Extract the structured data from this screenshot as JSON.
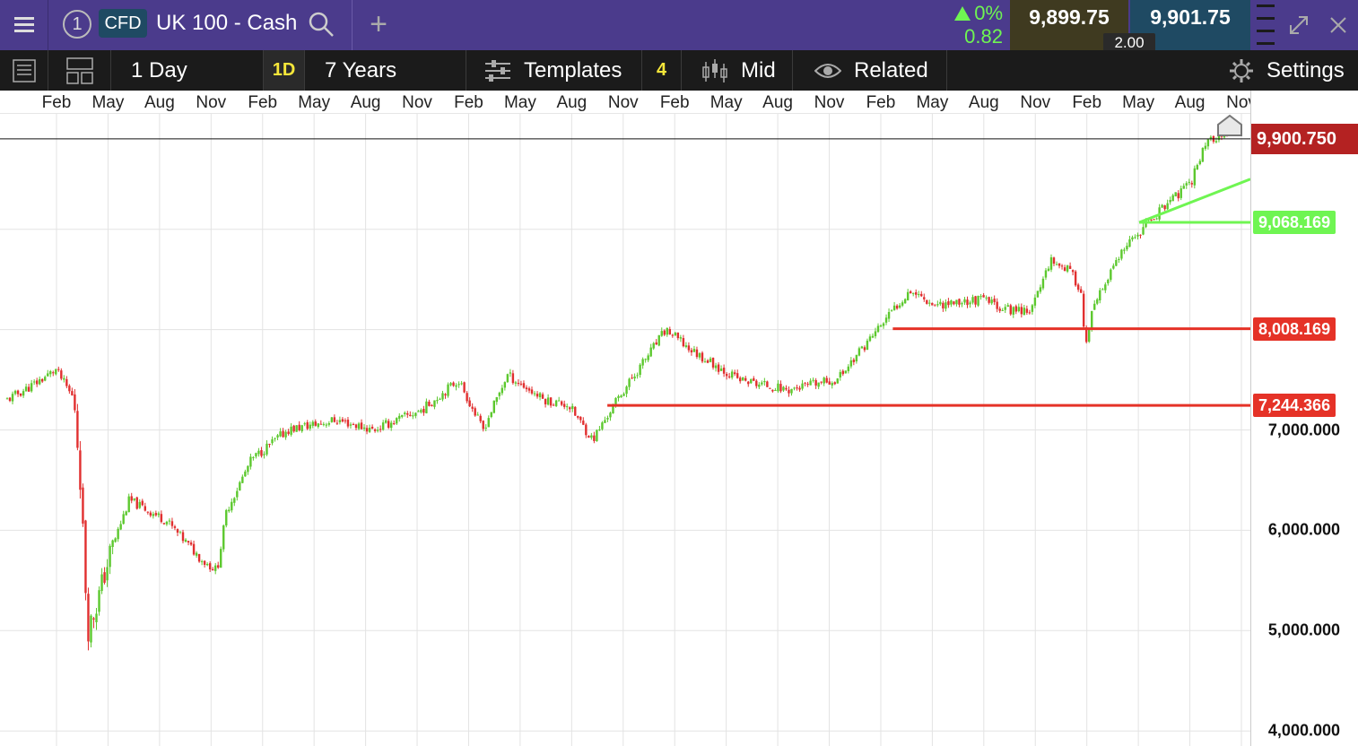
{
  "header": {
    "instrument_type": "CFD",
    "instrument_name": "UK 100 - Cash",
    "badge_number": "1",
    "add_symbol": "+",
    "change_percent": "0%",
    "change_value": "0.82",
    "sell_price": "9,899.75",
    "buy_price": "9,901.75",
    "spread": "2.00"
  },
  "toolbar": {
    "interval": "1 Day",
    "interval_code": "1D",
    "range": "7 Years",
    "templates_label": "Templates",
    "templates_count": "4",
    "price_mode": "Mid",
    "related_label": "Related",
    "settings_label": "Settings"
  },
  "colors": {
    "header_bg": "#4b3b8c",
    "toolbar_bg": "#1b1b1b",
    "up": "#5cc82e",
    "down": "#e12f2f",
    "current_price_bg": "#b42222",
    "support_line": "#e53227",
    "trend_line": "#6ff552",
    "interval_badge": "#f5e63a"
  },
  "chart_data": {
    "type": "candlestick",
    "x_tick_labels": [
      "Feb",
      "May",
      "Aug",
      "Nov",
      "Feb",
      "May",
      "Aug",
      "Nov",
      "Feb",
      "May",
      "Aug",
      "Nov",
      "Feb",
      "May",
      "Aug",
      "Nov",
      "Feb",
      "May",
      "Aug",
      "Nov",
      "Feb",
      "May",
      "Aug",
      "Nov"
    ],
    "y_ticks": [
      7000,
      6000,
      5000,
      4000
    ],
    "y_tick_labels": [
      "7,000.000",
      "6,000.000",
      "5,000.000",
      "4,000.000"
    ],
    "y_range": [
      3850,
      10150
    ],
    "gridlines": true,
    "current_price": 9900.75,
    "current_price_label": "9,900.750",
    "horizontal_lines": [
      {
        "value": 9068.169,
        "label": "9,068.169",
        "color": "#6ff552"
      },
      {
        "value": 8008.169,
        "label": "8,008.169",
        "color": "#e53227"
      },
      {
        "value": 7244.366,
        "label": "7,244.366",
        "color": "#e53227"
      }
    ],
    "trend_path": [
      [
        0.0,
        7300
      ],
      [
        0.02,
        7440
      ],
      [
        0.04,
        7600
      ],
      [
        0.055,
        7300
      ],
      [
        0.06,
        6500
      ],
      [
        0.066,
        5000
      ],
      [
        0.072,
        5200
      ],
      [
        0.085,
        5800
      ],
      [
        0.1,
        6300
      ],
      [
        0.13,
        6100
      ],
      [
        0.16,
        5700
      ],
      [
        0.172,
        5600
      ],
      [
        0.18,
        6200
      ],
      [
        0.2,
        6700
      ],
      [
        0.23,
        7000
      ],
      [
        0.27,
        7100
      ],
      [
        0.3,
        7000
      ],
      [
        0.34,
        7200
      ],
      [
        0.37,
        7500
      ],
      [
        0.39,
        7000
      ],
      [
        0.41,
        7550
      ],
      [
        0.44,
        7300
      ],
      [
        0.46,
        7250
      ],
      [
        0.48,
        6900
      ],
      [
        0.5,
        7300
      ],
      [
        0.54,
        8000
      ],
      [
        0.56,
        7800
      ],
      [
        0.6,
        7500
      ],
      [
        0.64,
        7400
      ],
      [
        0.68,
        7500
      ],
      [
        0.72,
        8100
      ],
      [
        0.74,
        8400
      ],
      [
        0.76,
        8250
      ],
      [
        0.8,
        8300
      ],
      [
        0.82,
        8200
      ],
      [
        0.84,
        8200
      ],
      [
        0.855,
        8700
      ],
      [
        0.87,
        8600
      ],
      [
        0.88,
        8400
      ],
      [
        0.884,
        7800
      ],
      [
        0.89,
        8200
      ],
      [
        0.91,
        8700
      ],
      [
        0.93,
        9000
      ],
      [
        0.95,
        9250
      ],
      [
        0.97,
        9450
      ],
      [
        0.98,
        9800
      ],
      [
        0.985,
        9900
      ]
    ]
  }
}
